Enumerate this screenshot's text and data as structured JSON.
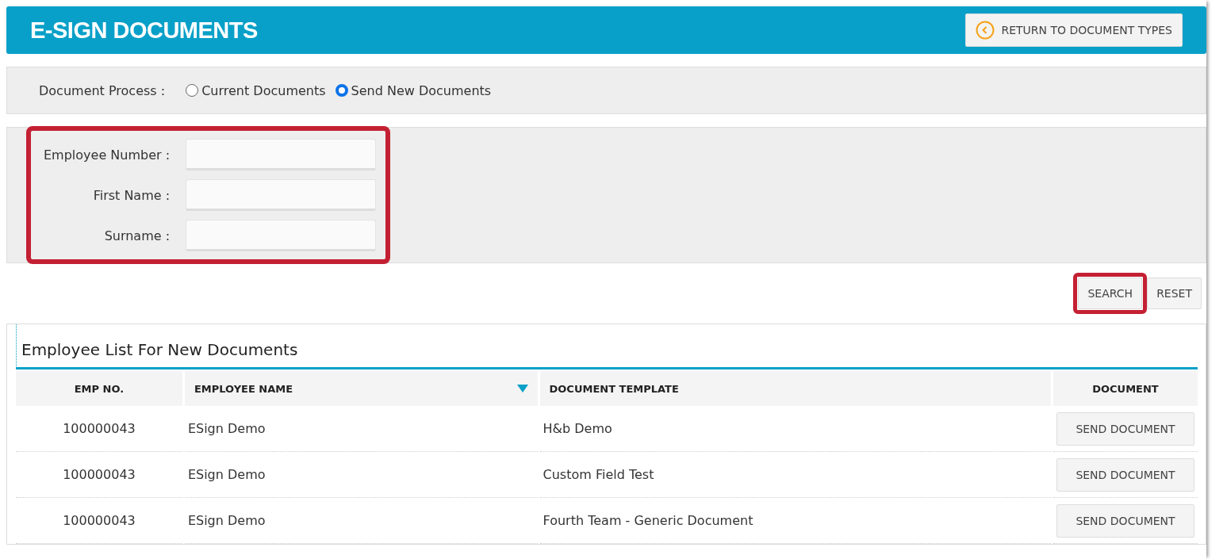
{
  "header": {
    "title": "E-SIGN DOCUMENTS",
    "return_button": "RETURN TO DOCUMENT TYPES"
  },
  "document_process": {
    "label": "Document Process :",
    "options": [
      {
        "label": "Current Documents",
        "selected": false
      },
      {
        "label": "Send New Documents",
        "selected": true
      }
    ]
  },
  "filters": {
    "highlighted": true,
    "fields": [
      {
        "label": "Employee Number :"
      },
      {
        "label": "First Name :"
      },
      {
        "label": "Surname :"
      }
    ]
  },
  "actions": [
    {
      "label": "SEARCH",
      "highlighted": true
    },
    {
      "label": "RESET",
      "highlighted": false
    }
  ],
  "table": {
    "title": "Employee List For New Documents",
    "columns": [
      {
        "label": "EMP NO.",
        "centered": true
      },
      {
        "label": "EMPLOYEE NAME",
        "centered": false,
        "sorted_descending": true
      },
      {
        "label": "DOCUMENT TEMPLATE",
        "centered": false
      },
      {
        "label": "DOCUMENT",
        "centered": true
      }
    ],
    "rows": [
      {
        "emp_no": "100000043",
        "name": "ESign Demo",
        "template": "H&b Demo",
        "action": "SEND DOCUMENT"
      },
      {
        "emp_no": "100000043",
        "name": "ESign Demo",
        "template": "Custom Field Test",
        "action": "SEND DOCUMENT"
      },
      {
        "emp_no": "100000043",
        "name": "ESign Demo",
        "template": "Fourth Team - Generic Document",
        "action": "SEND DOCUMENT"
      }
    ]
  }
}
